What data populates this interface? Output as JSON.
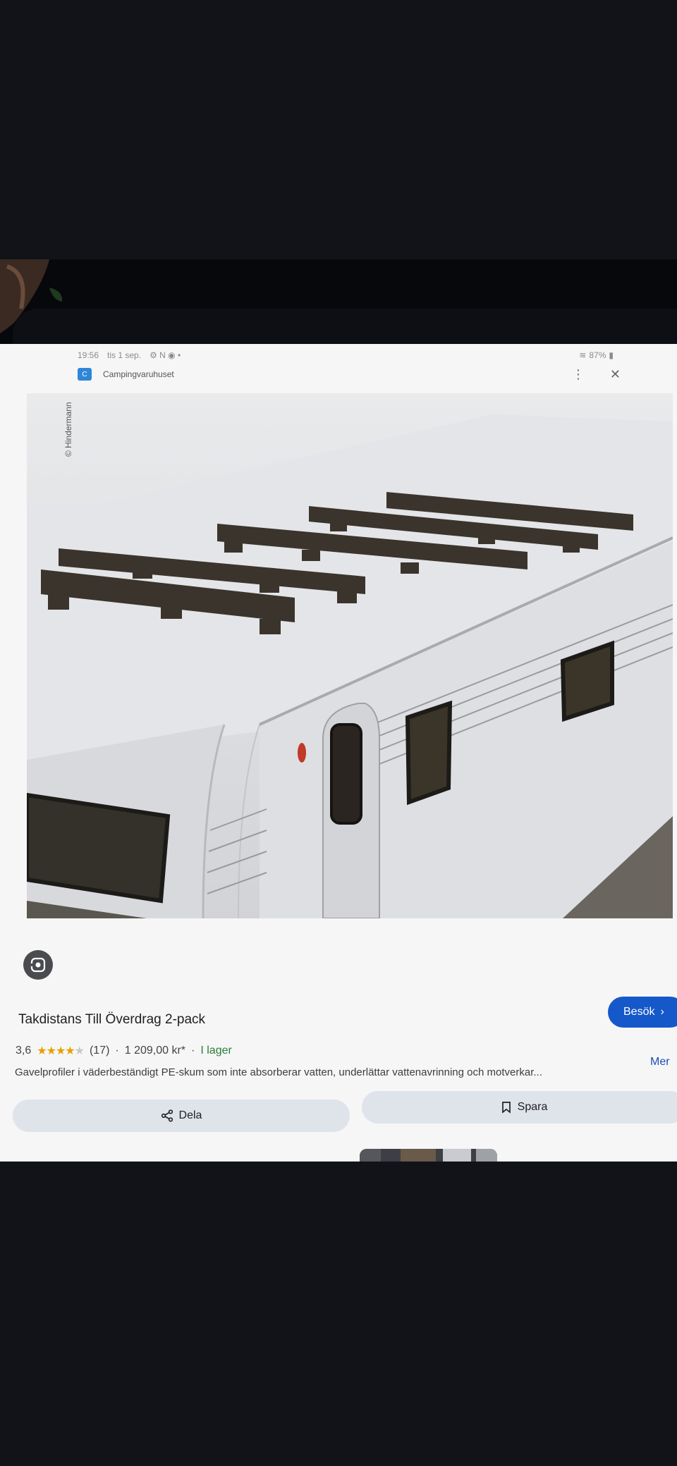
{
  "status_bar": {
    "time": "19:56",
    "date": "tis 1 sep.",
    "status_icons": "⚙ N ◉ •",
    "battery": "87%"
  },
  "app_bar": {
    "source_name": "Campingvaruhuset",
    "favicon": "C"
  },
  "image": {
    "watermark": "© Hindermann"
  },
  "product": {
    "title": "Takdistans Till Överdrag 2-pack",
    "rating": "3,6",
    "rating_value": 3.6,
    "reviews": "(17)",
    "price": "1 209,00 kr*",
    "separator": "·",
    "stock": "I lager",
    "description": "Gavelprofiler i väderbeständigt PE-skum som inte absorberar vatten, underlättar vattenavrinning och motverkar...",
    "more_label": "Mer"
  },
  "buttons": {
    "visit_label": "Besök",
    "share_label": "Dela",
    "save_label": "Spara"
  },
  "colors": {
    "primary": "#1558c9",
    "star": "#e6a000",
    "stock": "#2a7d3a"
  }
}
